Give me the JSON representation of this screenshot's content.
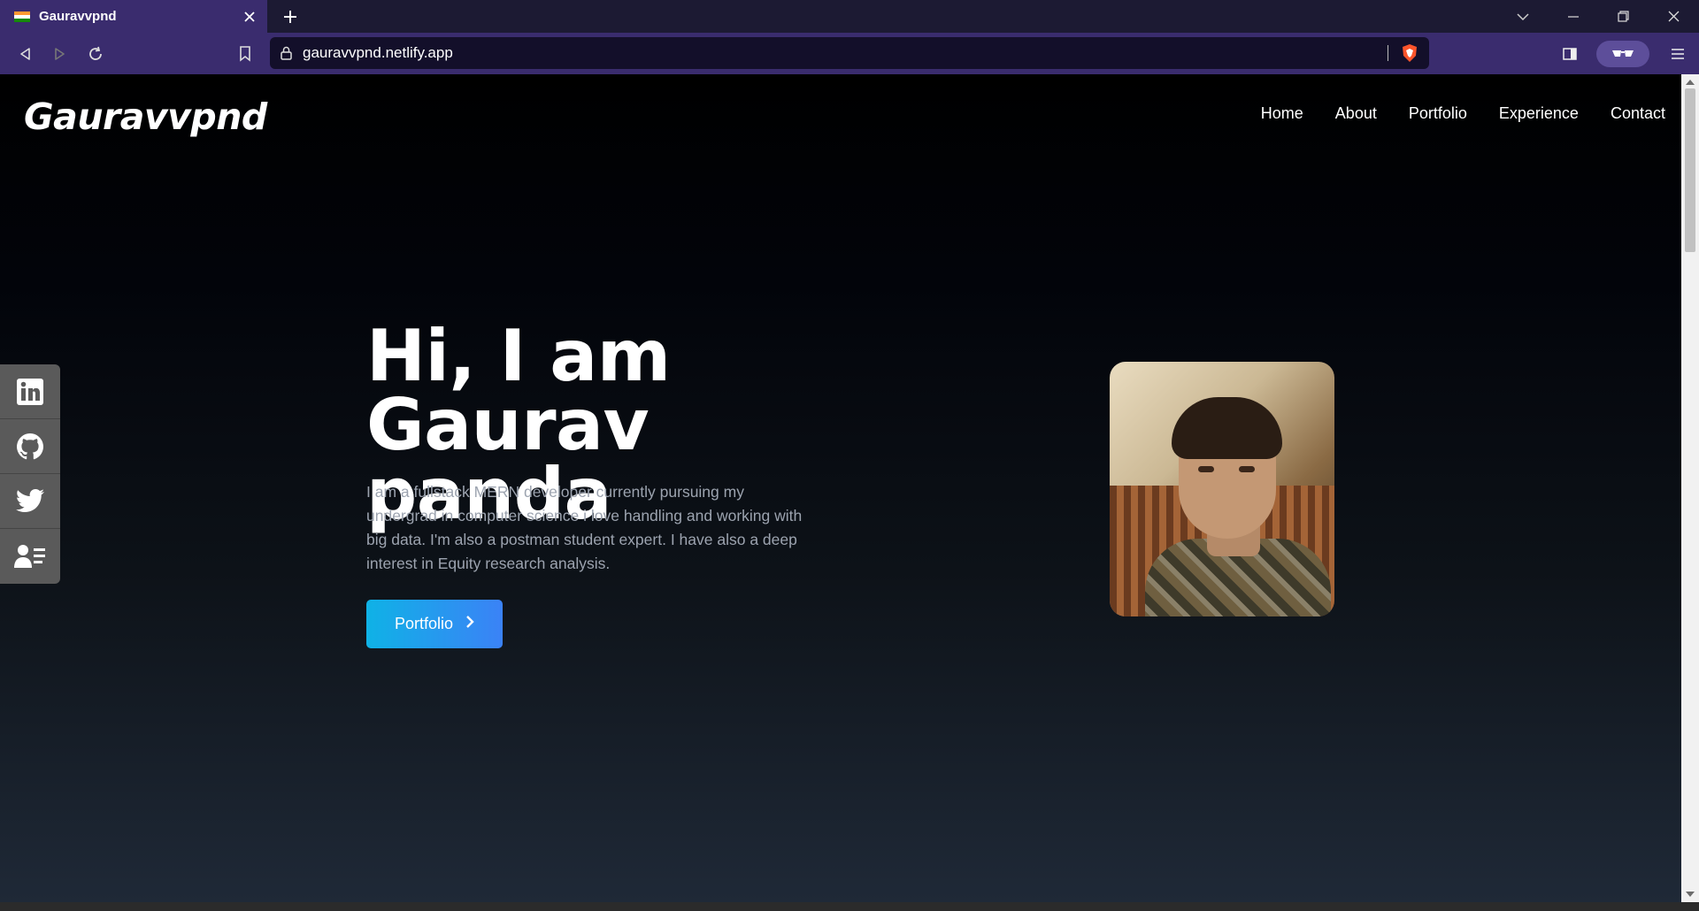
{
  "browser": {
    "tab_title": "Gauravvpnd",
    "url": "gauravvpnd.netlify.app"
  },
  "site": {
    "logo": "Gauravvpnd",
    "nav": [
      "Home",
      "About",
      "Portfolio",
      "Experience",
      "Contact"
    ],
    "social": [
      "linkedin-icon",
      "github-icon",
      "twitter-icon",
      "resume-icon"
    ]
  },
  "hero": {
    "title_line1": "Hi, I am Gaurav",
    "title_line2": "panda",
    "description": "I am a fullstack MERN developer currently pursuing my undergrad in computer science i love handling and working with big data. I'm also a postman student expert. I have also a deep interest in Equity research analysis.",
    "button_label": "Portfolio"
  },
  "colors": {
    "chrome_tab": "#3a2c6e",
    "url_bg": "#130f2a",
    "button_gradient_start": "#0fb2e6",
    "button_gradient_end": "#3b82f6"
  }
}
